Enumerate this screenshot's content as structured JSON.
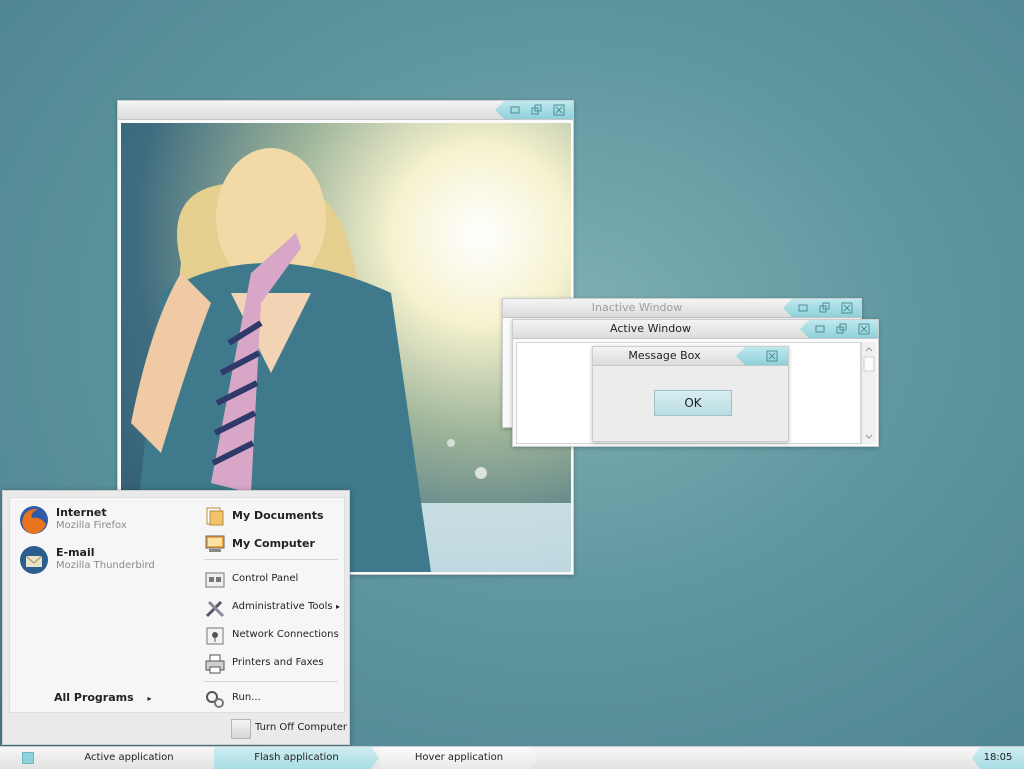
{
  "windows": {
    "photo": {
      "title": ""
    },
    "inactive": {
      "title": "Inactive Window"
    },
    "active": {
      "title": "Active Window"
    },
    "message_box": {
      "title": "Message Box",
      "ok_label": "OK"
    }
  },
  "start_menu": {
    "pinned": [
      {
        "title": "Internet",
        "subtitle": "Mozilla Firefox",
        "icon": "firefox-icon"
      },
      {
        "title": "E-mail",
        "subtitle": "Mozilla Thunderbird",
        "icon": "thunderbird-icon"
      }
    ],
    "all_programs": "All Programs",
    "places": [
      {
        "label": "My Documents",
        "icon": "documents-icon"
      },
      {
        "label": "My Computer",
        "icon": "computer-icon"
      },
      {
        "label": "Control Panel",
        "icon": "control-panel-icon"
      },
      {
        "label": "Administrative Tools",
        "icon": "tools-icon"
      },
      {
        "label": "Network Connections",
        "icon": "network-icon"
      },
      {
        "label": "Printers and Faxes",
        "icon": "printer-icon"
      },
      {
        "label": "Run...",
        "icon": "run-icon"
      }
    ],
    "turn_off": "Turn Off Computer"
  },
  "taskbar": {
    "tasks": [
      {
        "label": "Active application",
        "state": "active"
      },
      {
        "label": "Flash application",
        "state": "flash"
      },
      {
        "label": "Hover application",
        "state": "hover"
      }
    ],
    "clock": "18:05"
  },
  "colors": {
    "accent": "#9fdde5",
    "desktop": "#5f979f"
  }
}
